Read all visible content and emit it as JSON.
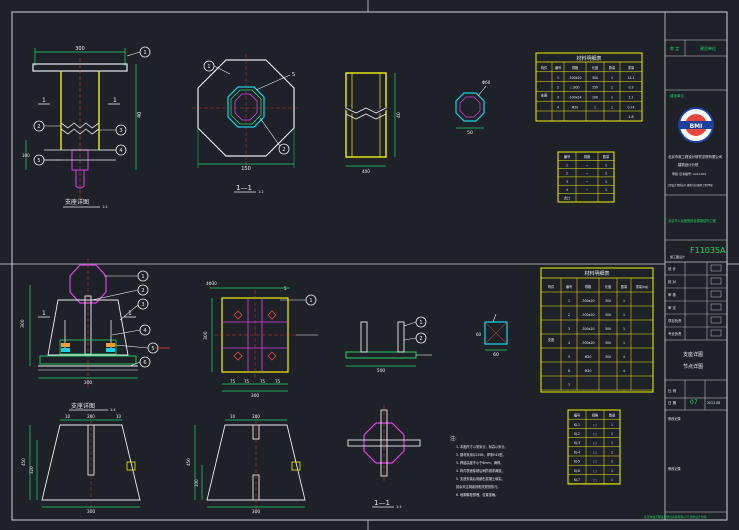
{
  "colors": {
    "bg": "#1e2127",
    "frame": "#cfd3d8",
    "yellow": "#f2f20a",
    "green": "#22d46a",
    "white": "#e9ecef",
    "magenta": "#e040e8",
    "cyan": "#19d3e6",
    "red": "#e8453c",
    "orange": "#f0a030"
  },
  "views": {
    "support_detail": {
      "title": "支座详图",
      "scale": "1:2"
    },
    "section_top": {
      "title": "1—1",
      "scale": "1:2"
    },
    "support_detail_lower": {
      "title": "支座详图",
      "scale": "1:4"
    },
    "section_lower": {
      "title": "1—1",
      "scale": "1:4"
    }
  },
  "dims": {
    "top_width": "300",
    "top_height": "40",
    "top_small": "100",
    "oct_width": "150",
    "oct_r": "60",
    "weld_width": "400",
    "cyan_dim": "50",
    "cyan_label": "Φ60",
    "lower_width": "300",
    "lower_h1": "300",
    "lower_h2": "150",
    "plate_w": "300",
    "plate_h": "300",
    "plate_a": "75",
    "plate_b": "75",
    "plate_c": "75",
    "plate_d": "75",
    "plate_top": "4Φ30",
    "plate_right": "5",
    "elev_width": "500",
    "small_sq": "60",
    "small_sq_b": "60",
    "trap_top_a": "10",
    "trap_top_b": "200",
    "trap_top_c": "10",
    "trap_bottom": "300",
    "trap_h": "450",
    "trap_h_sub": "320",
    "trap_h_sub2": "100",
    "trap2_bottom": "300",
    "trap2_top_a": "10",
    "trap2_top_b": "200",
    "trap2_h": "450"
  },
  "callouts": [
    "1",
    "2",
    "3",
    "4",
    "5",
    "6",
    "7"
  ],
  "labels": {
    "oct_mark": "5",
    "weld_sym": "6",
    "section_mark": "1"
  },
  "table1": {
    "title": "材料明细表",
    "headers": [
      "构件",
      "编号",
      "规格",
      "长度",
      "数量",
      "重量"
    ],
    "rows": [
      [
        "",
        "1",
        "-300x20",
        "300",
        "1",
        "14.1"
      ],
      [
        "",
        "2",
        "□300",
        "150",
        "1",
        "0.3"
      ],
      [
        "",
        "3",
        "-100x14",
        "100",
        "1",
        "1.1"
      ],
      [
        "",
        "4",
        "Φ20",
        "1",
        "1",
        "0.74"
      ],
      [
        "",
        "",
        "",
        "",
        "",
        "4.8"
      ]
    ],
    "group": "支座"
  },
  "table2": {
    "headers": [
      "编号",
      "规格",
      "数量"
    ],
    "rows": [
      [
        "1",
        "─",
        "1"
      ],
      [
        "2",
        "─",
        "2"
      ],
      [
        "3",
        "─",
        "1"
      ],
      [
        "4",
        "─",
        "1"
      ],
      [
        "合计",
        "",
        ""
      ]
    ]
  },
  "table3": {
    "title": "材料明细表",
    "headers": [
      "构件",
      "编号",
      "规格",
      "长度",
      "数量",
      "重量(kg)"
    ],
    "rows": [
      [
        "",
        "1",
        "-300x20",
        "300",
        "1",
        ""
      ],
      [
        "",
        "2",
        "-300x20",
        "300",
        "1",
        ""
      ],
      [
        "",
        "3",
        "-300x20",
        "300",
        "1",
        ""
      ],
      [
        "",
        "4",
        "-300x20",
        "300",
        "1",
        ""
      ],
      [
        "",
        "5",
        "M20",
        "300",
        "4",
        ""
      ],
      [
        "",
        "6",
        "M20",
        "",
        "4",
        ""
      ],
      [
        "",
        "7",
        "",
        "",
        "",
        ""
      ]
    ],
    "group": "支座"
  },
  "table4": {
    "headers": [
      "编号",
      "规格",
      "数量"
    ],
    "rows": [
      [
        "KJ-1",
        "□",
        "1"
      ],
      [
        "KJ-2",
        "□",
        "1"
      ],
      [
        "KJ-3",
        "□",
        "1"
      ],
      [
        "KJ-4",
        "□",
        "1"
      ],
      [
        "KJ-5",
        "□",
        "1"
      ],
      [
        "KJ-6",
        "□",
        "1"
      ],
      [
        "KJ-7",
        "□",
        "1"
      ]
    ]
  },
  "notes": {
    "title": "注:",
    "lines": [
      "1. 本图尺寸以毫米计，标高以米计。",
      "2. 钢材采用Q235B，焊条E43型。",
      "3. 焊缝高度不小于6mm，满焊。",
      "4. 构件表面除锈后刷防锈漆两道。",
      "5. 支座安装后用细石混凝土填实。",
      "   其余未注明者按相关规范执行。",
      "6. 地脚螺栓预埋，位置准确。"
    ]
  },
  "titleblock": {
    "tag1": "审 定",
    "tag2": "建设单位",
    "company": "北京市政工程设计研究总院有限公司",
    "company2": "建筑设计分院",
    "cert": "甲级 证书编号: A111001",
    "addr": "工程设计资质证书 建筑行业(建筑工程)甲级",
    "project": "北京市人民医院综合楼钢结构工程",
    "drawing_no": "F11035A",
    "stage": "施工图设计",
    "drawing_title1": "支座详图",
    "drawing_title2": "节点详图",
    "rows": [
      [
        "设 计",
        ""
      ],
      [
        "校 对",
        ""
      ],
      [
        "审 核",
        ""
      ],
      [
        "审 定",
        ""
      ],
      [
        "项目负责",
        ""
      ],
      [
        "专业负责",
        ""
      ]
    ],
    "scale": "比 例",
    "sheet": "07",
    "date": "日 期",
    "date_val": "2012.08",
    "rev": "修改记录",
    "footer": "北京市政工程设计研究总院有限公司 建筑设计分院"
  }
}
